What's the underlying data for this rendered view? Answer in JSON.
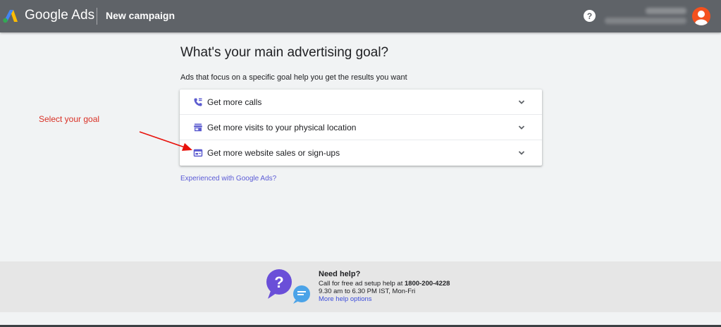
{
  "header": {
    "brand": "Google Ads",
    "campaign_title": "New campaign",
    "help_label": "?",
    "brand_colors": {
      "bar": "#5f6368",
      "avatar": "#f4511e"
    }
  },
  "main": {
    "heading": "What's your main advertising goal?",
    "subheading": "Ads that focus on a specific goal help you get the results you want",
    "goals": [
      {
        "label": "Get more calls",
        "icon": "phone-icon"
      },
      {
        "label": "Get more visits to your physical location",
        "icon": "store-icon"
      },
      {
        "label": "Get more website sales or sign-ups",
        "icon": "website-icon"
      }
    ],
    "experienced_link": "Experienced with Google Ads?",
    "accent_color": "#5b5bd6"
  },
  "annotation": {
    "text": "Select your goal",
    "color": "#d93025"
  },
  "footer": {
    "need_help": "Need help?",
    "call_prefix": "Call for free ad setup help at ",
    "phone": "1800-200-4228",
    "hours": "9.30 am to 6.30 PM IST, Mon-Fri",
    "more_help": "More help options"
  }
}
